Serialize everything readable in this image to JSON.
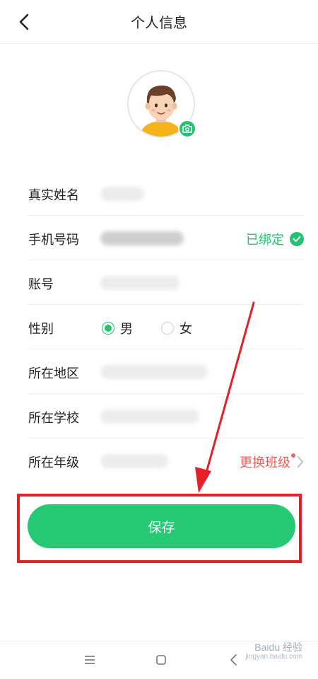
{
  "header": {
    "title": "个人信息"
  },
  "form": {
    "real_name": {
      "label": "真实姓名"
    },
    "phone": {
      "label": "手机号码",
      "status": "已绑定"
    },
    "account": {
      "label": "账号"
    },
    "gender": {
      "label": "性别",
      "options": [
        "男",
        "女"
      ],
      "selected": "男"
    },
    "region": {
      "label": "所在地区"
    },
    "school": {
      "label": "所在学校"
    },
    "grade": {
      "label": "所在年级",
      "action": "更换班级"
    }
  },
  "save": {
    "label": "保存"
  },
  "watermark": {
    "brand": "Baidu 经验",
    "url": "jingyan.baidu.com"
  },
  "colors": {
    "accent": "#27c174",
    "annotation": "#e5202b",
    "warning": "#f0645a"
  }
}
